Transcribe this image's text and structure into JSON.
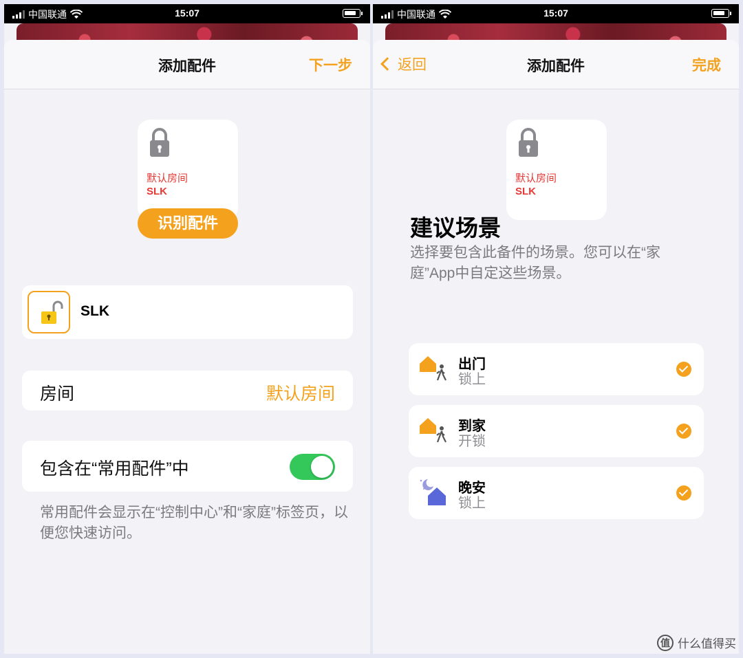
{
  "status_bar": {
    "carrier": "中国联通",
    "time": "15:07"
  },
  "left": {
    "nav": {
      "title": "添加配件",
      "next": "下一步"
    },
    "tile": {
      "room": "默认房间",
      "name": "SLK"
    },
    "identify_button": "识别配件",
    "accessory": {
      "name": "SLK"
    },
    "room_row": {
      "label": "房间",
      "value": "默认房间"
    },
    "favorites_row": {
      "label": "包含在“常用配件”中",
      "toggle_on": true
    },
    "footnote": "常用配件会显示在“控制中心”和“家庭”标签页，以便您快速访问。"
  },
  "right": {
    "nav": {
      "back": "返回",
      "title": "添加配件",
      "done": "完成"
    },
    "tile": {
      "room": "默认房间",
      "name": "SLK"
    },
    "scenes_title": "建议场景",
    "scenes_desc": "选择要包含此备件的场景。您可以在“家庭”App中自定这些场景。",
    "scenes": [
      {
        "name": "出门",
        "action": "锁上",
        "icon": "house-person-icon",
        "checked": true
      },
      {
        "name": "到家",
        "action": "开锁",
        "icon": "house-person-icon",
        "checked": true
      },
      {
        "name": "晚安",
        "action": "锁上",
        "icon": "moon-house-icon",
        "checked": true
      }
    ]
  },
  "watermark": {
    "text": "什么值得买",
    "logo": "值"
  },
  "colors": {
    "accent": "#f4a11e",
    "toggle": "#34c759",
    "tile_text": "#e53935"
  }
}
